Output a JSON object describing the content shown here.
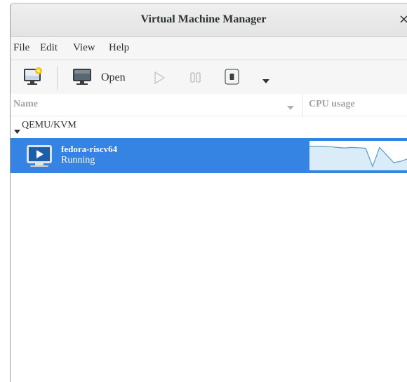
{
  "window": {
    "title": "Virtual Machine Manager",
    "close_glyph": "×"
  },
  "menubar": {
    "file": "File",
    "edit": "Edit",
    "view": "View",
    "help": "Help"
  },
  "toolbar": {
    "new_vm_icon": "new-vm-icon",
    "open_icon": "monitor-icon",
    "open_label": "Open",
    "run_icon": "play-icon",
    "pause_icon": "pause-icon",
    "shutdown_icon": "shutdown-icon",
    "menu_icon": "dropdown-arrow-icon"
  },
  "columns": {
    "name": "Name",
    "cpu": "CPU usage"
  },
  "groups": [
    {
      "label": "QEMU/KVM",
      "vms": [
        {
          "name": "fedora-riscv64",
          "status": "Running",
          "cpu_usage_trend": [
            0.9,
            0.9,
            0.9,
            0.88,
            0.85,
            0.83,
            0.85,
            0.84,
            0.82,
            0.1,
            0.85,
            0.55,
            0.25,
            0.3,
            0.4,
            0.35,
            0.3
          ]
        }
      ]
    }
  ],
  "colors": {
    "selection": "#3584e4",
    "graph_fill": "#d9ecf8",
    "graph_line": "#5a9cc8"
  }
}
